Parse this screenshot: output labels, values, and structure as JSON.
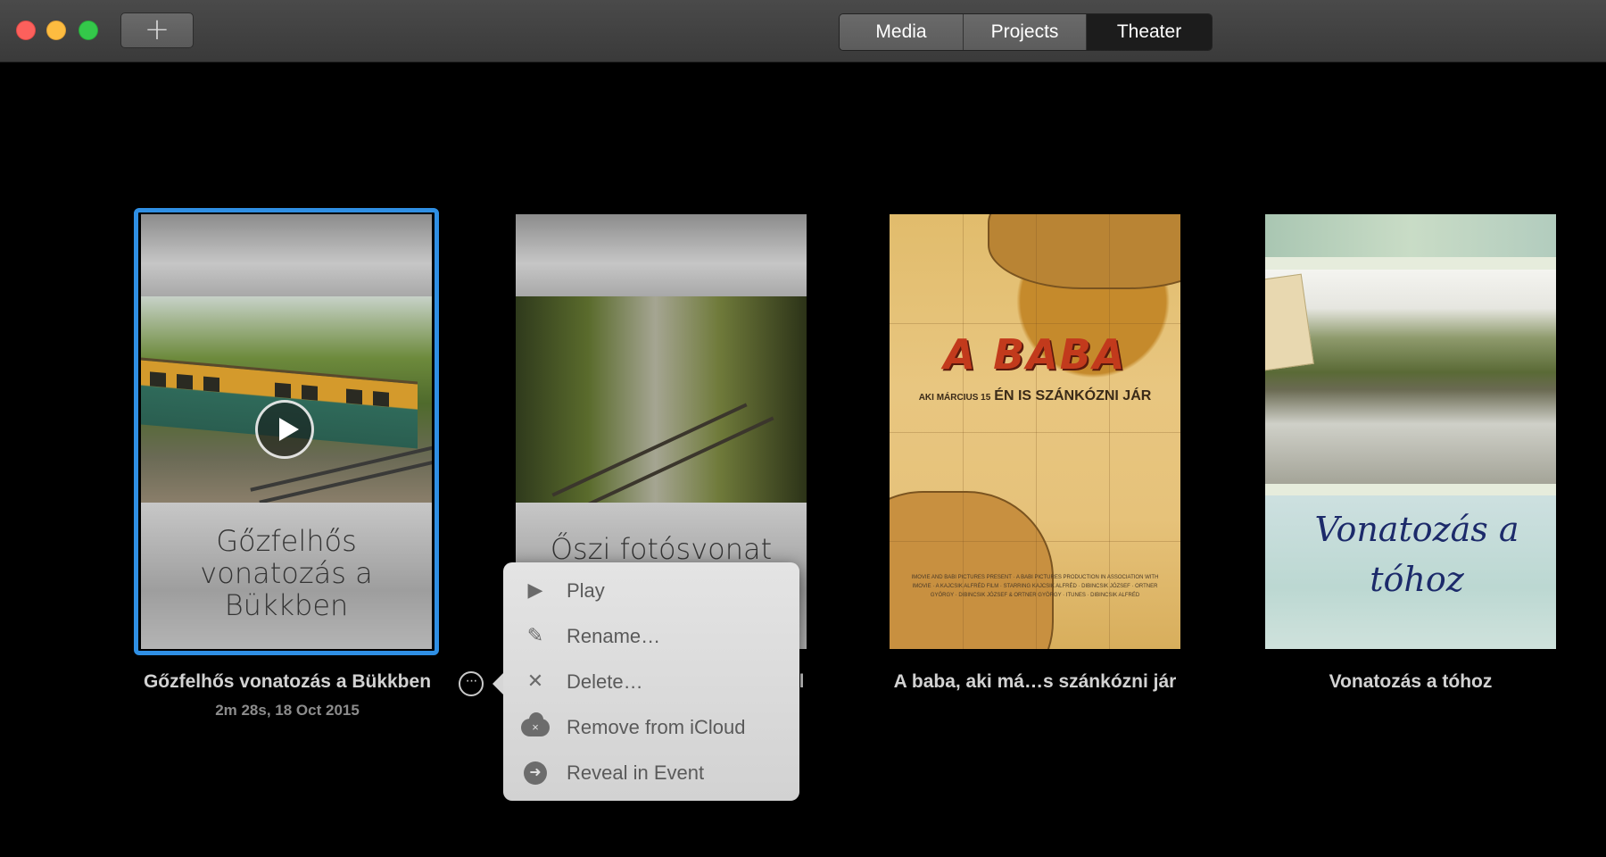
{
  "toolbar": {
    "add_label": "+",
    "tabs": [
      {
        "label": "Media",
        "selected": false
      },
      {
        "label": "Projects",
        "selected": false
      },
      {
        "label": "Theater",
        "selected": true
      }
    ]
  },
  "posters": [
    {
      "title": "Gőzfelhős vonatozás a Bükkben",
      "poster_title": "Gőzfelhős vonatozás a Bükkben",
      "meta": "2m 28s, 18 Oct 2015",
      "selected": true
    },
    {
      "title": "el",
      "poster_title": "Őszi fotósvonat"
    },
    {
      "title": "A baba, aki má…s szánkózni jár",
      "poster_title": "A BABA",
      "poster_sub_small": "AKI MÁRCIUS 15",
      "poster_sub": "ÉN IS SZÁNKÓZNI JÁR",
      "credits": "IMOVIE AND BABI PICTURES PRESENT · A BABI PICTURES PRODUCTION IN ASSOCIATION WITH IMOVIE · A KAJCSIK ALFRÉD FILM · STARRING KAJCSIK ALFRÉD · DIBINCSIK JÓZSEF · ORTNER GYÖRGY · DIBINCSIK JÓZSEF & ORTNER GYÖRGY · ITUNES · DIBINCSIK ALFRÉD"
    },
    {
      "title": "Vonatozás a tóhoz",
      "poster_title": "Vonatozás a tóhoz"
    }
  ],
  "context_menu": {
    "items": [
      {
        "label": "Play",
        "icon": "play-icon"
      },
      {
        "label": "Rename…",
        "icon": "pencil-icon"
      },
      {
        "label": "Delete…",
        "icon": "close-icon"
      },
      {
        "label": "Remove from iCloud",
        "icon": "cloud-remove-icon"
      },
      {
        "label": "Reveal in Event",
        "icon": "arrow-circle-icon"
      }
    ]
  },
  "more_button_label": "···",
  "colors": {
    "selection": "#2f8fe4",
    "background": "#000000",
    "toolbar": "#3f3f3f"
  }
}
